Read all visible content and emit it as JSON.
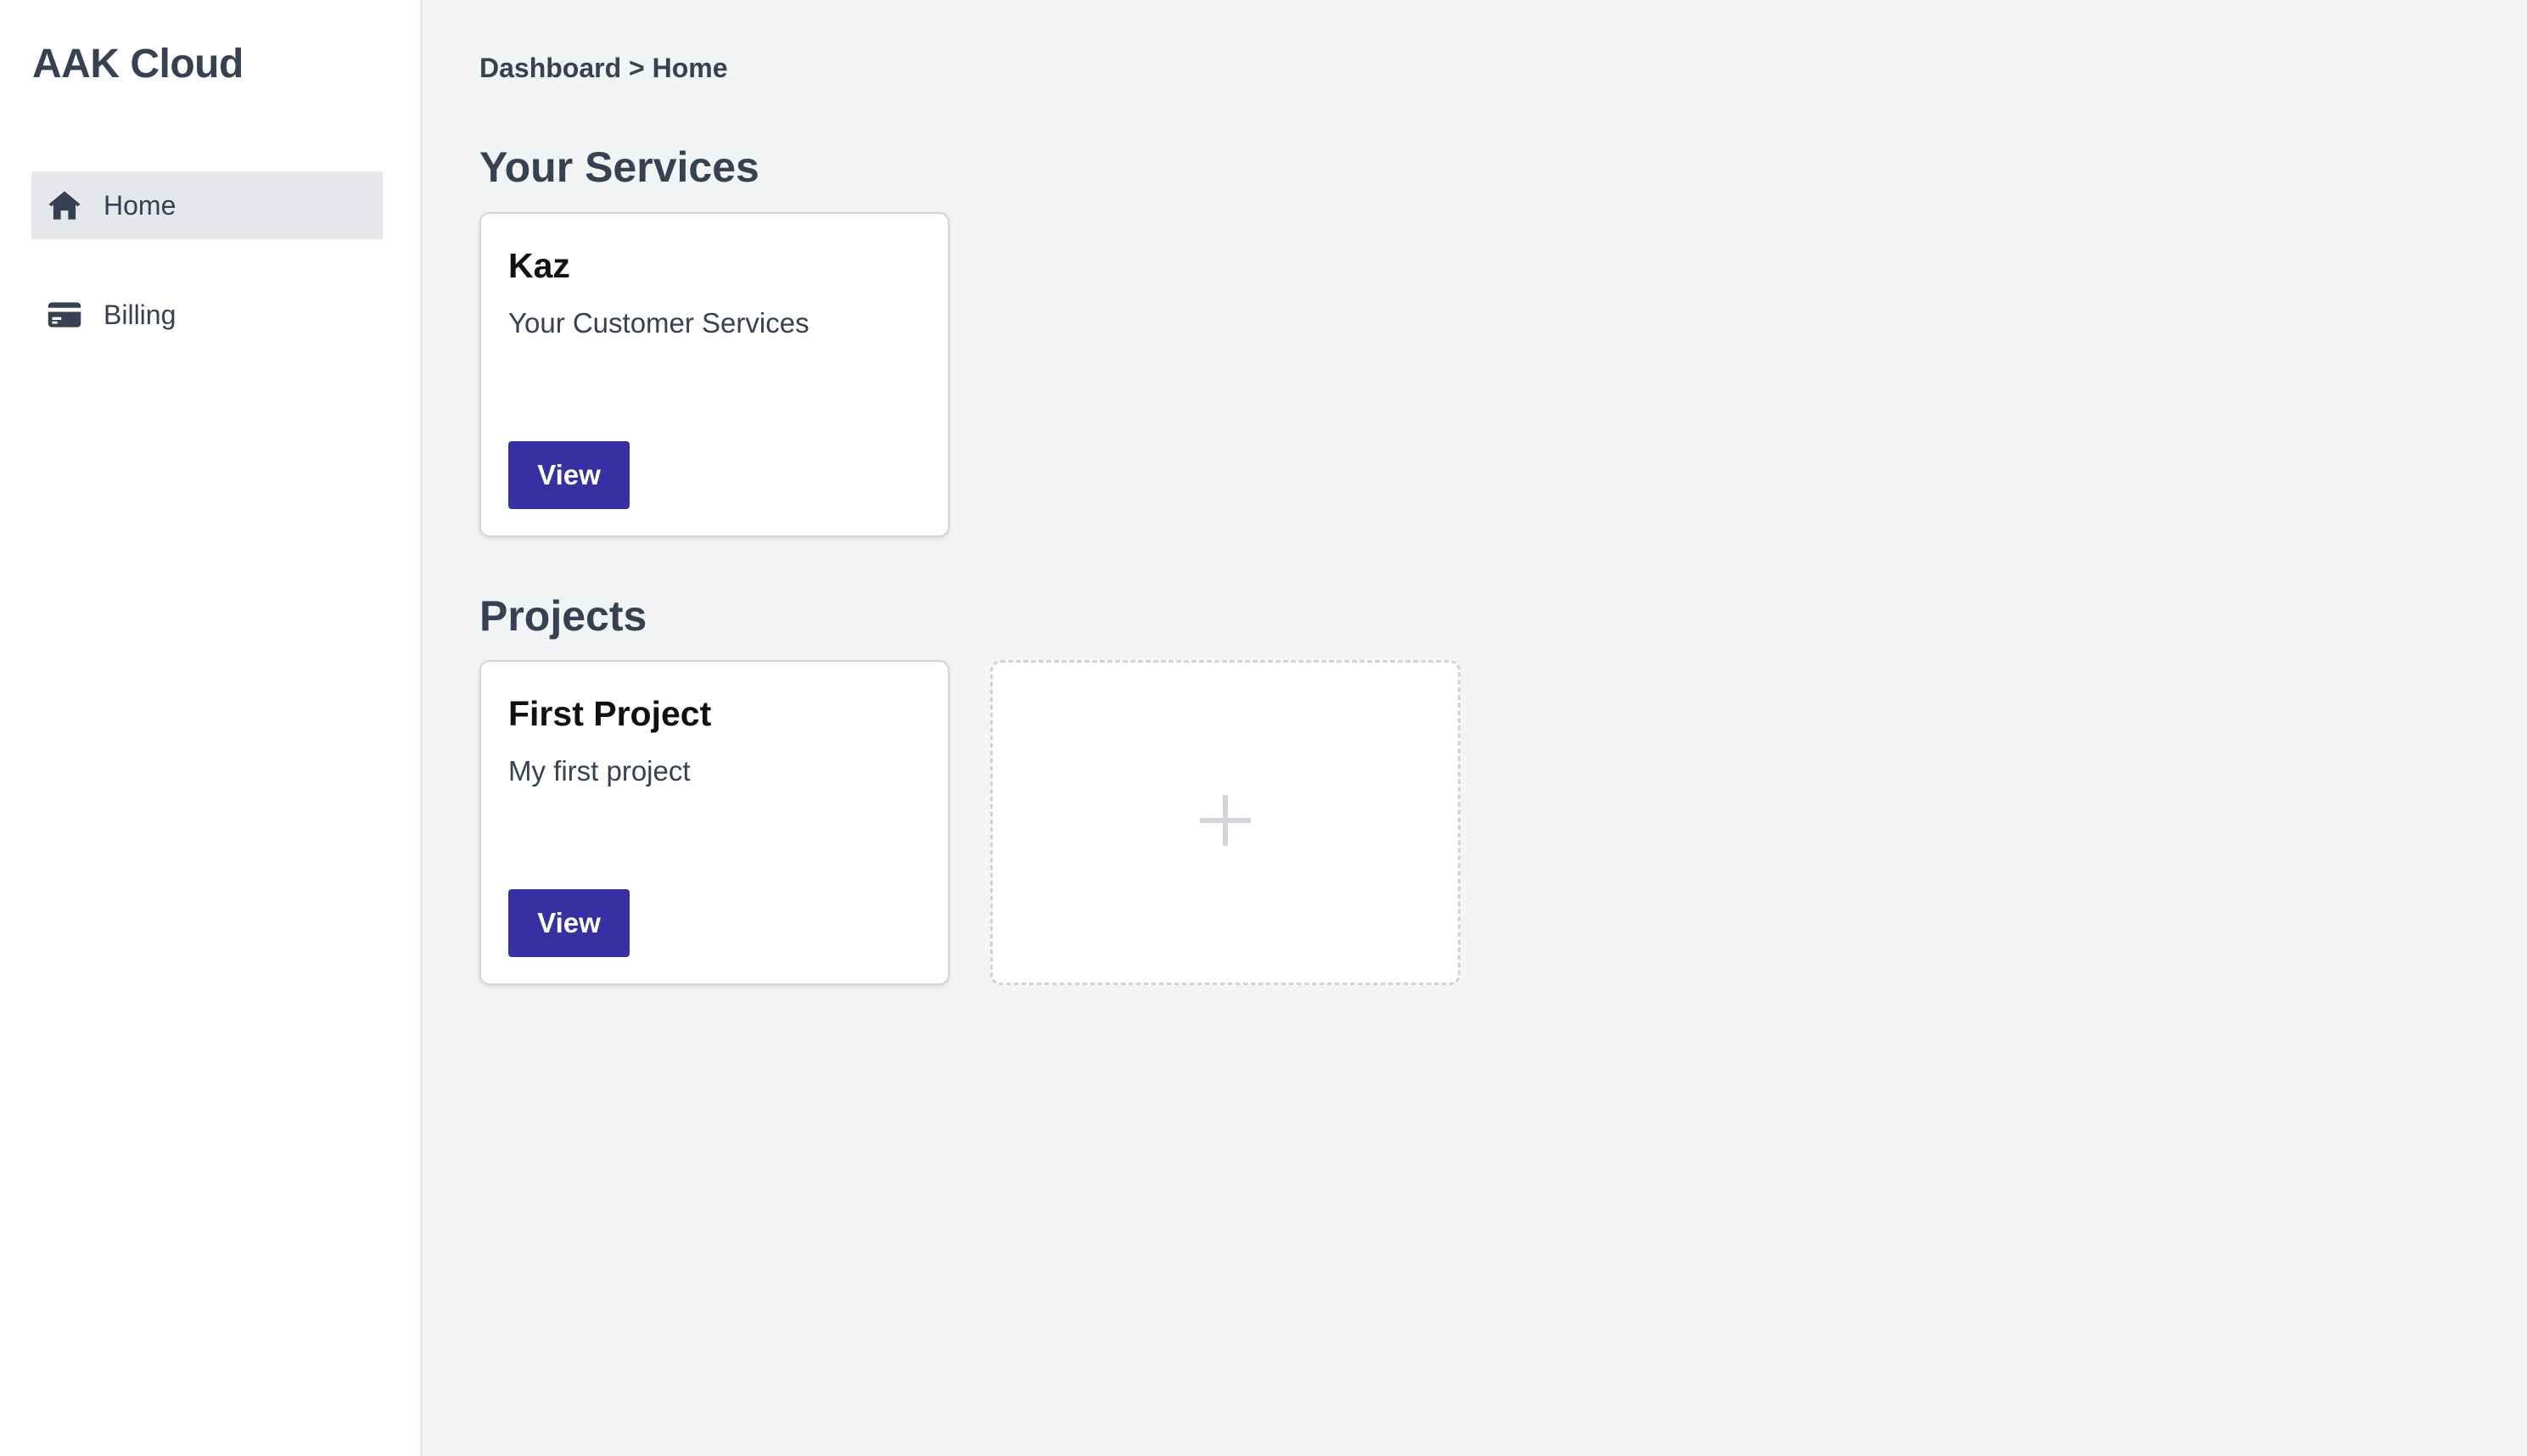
{
  "brand": {
    "name": "AAK Cloud"
  },
  "sidebar": {
    "items": [
      {
        "label": "Home",
        "icon": "home-icon",
        "active": true
      },
      {
        "label": "Billing",
        "icon": "credit-card-icon",
        "active": false
      }
    ]
  },
  "breadcrumb": {
    "text": "Dashboard > Home"
  },
  "services": {
    "title": "Your Services",
    "cards": [
      {
        "title": "Kaz",
        "description": "Your Customer Services",
        "button_label": "View"
      }
    ]
  },
  "projects": {
    "title": "Projects",
    "cards": [
      {
        "title": "First Project",
        "description": "My first project",
        "button_label": "View"
      }
    ],
    "add_card_icon": "plus-icon"
  },
  "colors": {
    "primary": "#3730a3",
    "sidebar_active_bg": "#e5e7eb",
    "page_bg": "#f3f4f6",
    "text": "#374151"
  }
}
